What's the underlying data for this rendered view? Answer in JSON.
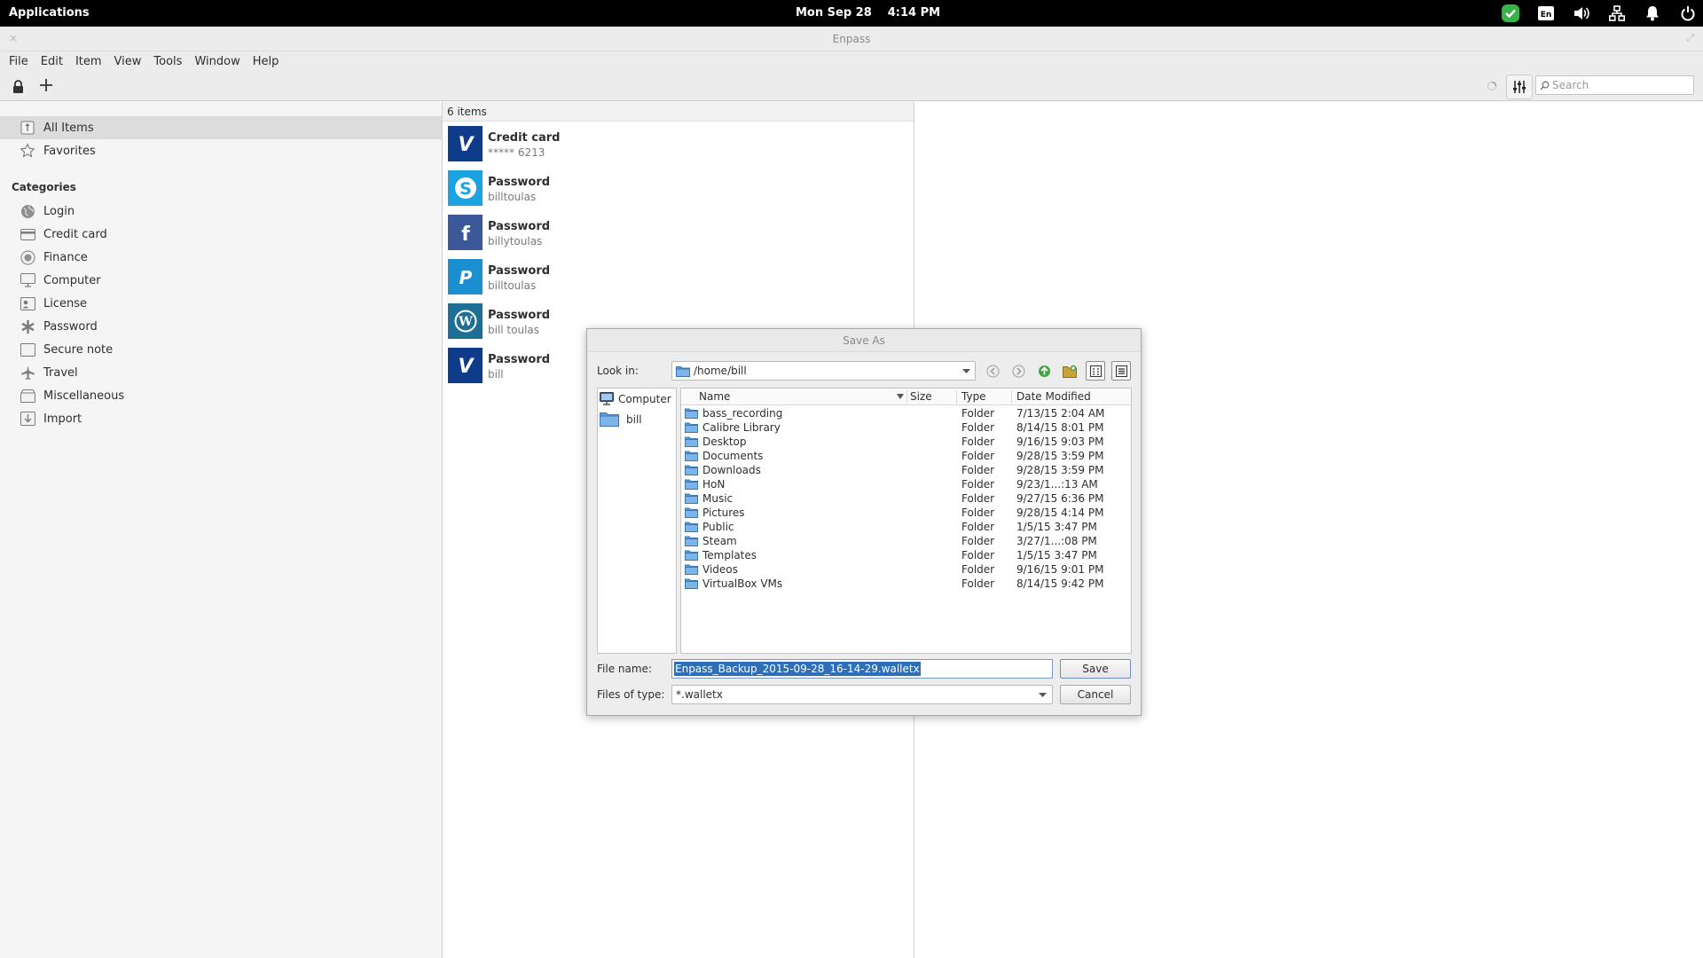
{
  "topbar": {
    "applications": "Applications",
    "date": "Mon Sep 28",
    "time": "4:14 PM",
    "tray": [
      "check-shield-icon",
      "keyboard-layout-icon",
      "volume-icon",
      "network-icon",
      "bell-icon",
      "power-icon"
    ],
    "keyboard_label": "En"
  },
  "window": {
    "title": "Enpass",
    "close": "×",
    "maximize": "⤢"
  },
  "menu": [
    "File",
    "Edit",
    "Item",
    "View",
    "Tools",
    "Window",
    "Help"
  ],
  "toolbar": {
    "search_placeholder": "Search"
  },
  "sidebar": {
    "top": [
      {
        "label": "All Items",
        "icon": "all-items-icon",
        "selected": true
      },
      {
        "label": "Favorites",
        "icon": "star-icon"
      }
    ],
    "categories_title": "Categories",
    "categories": [
      {
        "label": "Login",
        "icon": "globe-icon"
      },
      {
        "label": "Credit card",
        "icon": "credit-card-icon"
      },
      {
        "label": "Finance",
        "icon": "finance-icon"
      },
      {
        "label": "Computer",
        "icon": "computer-icon"
      },
      {
        "label": "License",
        "icon": "license-icon"
      },
      {
        "label": "Password",
        "icon": "asterisk-icon"
      },
      {
        "label": "Secure note",
        "icon": "note-icon"
      },
      {
        "label": "Travel",
        "icon": "plane-icon"
      },
      {
        "label": "Miscellaneous",
        "icon": "misc-icon"
      },
      {
        "label": "Import",
        "icon": "import-icon"
      }
    ]
  },
  "list": {
    "count": "6 items",
    "items": [
      {
        "title": "Credit card",
        "subtitle": "***** 6213",
        "logo": "visa-logo-icon",
        "color": "#0f3c8a",
        "glyph": "V"
      },
      {
        "title": "Password",
        "subtitle": "billtoulas",
        "logo": "skype-logo-icon",
        "color": "#1aa3e0",
        "glyph": "S"
      },
      {
        "title": "Password",
        "subtitle": "billytoulas",
        "logo": "facebook-logo-icon",
        "color": "#3b5998",
        "glyph": "f"
      },
      {
        "title": "Password",
        "subtitle": "billtoulas",
        "logo": "paypal-logo-icon",
        "color": "#1c8fd0",
        "glyph": "P"
      },
      {
        "title": "Password",
        "subtitle": "bill toulas",
        "logo": "wordpress-logo-icon",
        "color": "#1e6f95",
        "glyph": "W"
      },
      {
        "title": "Password",
        "subtitle": "bill",
        "logo": "visa-logo-icon",
        "color": "#0f3c8a",
        "glyph": "V"
      }
    ]
  },
  "dialog": {
    "title": "Save As",
    "look_in_label": "Look in:",
    "look_in_value": "/home/bill",
    "places": [
      {
        "label": "Computer",
        "icon": "computer-icon"
      },
      {
        "label": "bill",
        "icon": "folder-icon"
      }
    ],
    "columns": [
      "Name",
      "Size",
      "Type",
      "Date Modified"
    ],
    "files": [
      {
        "name": "bass_recording",
        "size": "",
        "type": "Folder",
        "date": "7/13/15 2:04 AM"
      },
      {
        "name": "Calibre Library",
        "size": "",
        "type": "Folder",
        "date": "8/14/15 8:01 PM"
      },
      {
        "name": "Desktop",
        "size": "",
        "type": "Folder",
        "date": "9/16/15 9:03 PM"
      },
      {
        "name": "Documents",
        "size": "",
        "type": "Folder",
        "date": "9/28/15 3:59 PM"
      },
      {
        "name": "Downloads",
        "size": "",
        "type": "Folder",
        "date": "9/28/15 3:59 PM"
      },
      {
        "name": "HoN",
        "size": "",
        "type": "Folder",
        "date": "9/23/1...:13 AM"
      },
      {
        "name": "Music",
        "size": "",
        "type": "Folder",
        "date": "9/27/15 6:36 PM"
      },
      {
        "name": "Pictures",
        "size": "",
        "type": "Folder",
        "date": "9/28/15 4:14 PM"
      },
      {
        "name": "Public",
        "size": "",
        "type": "Folder",
        "date": "1/5/15 3:47 PM"
      },
      {
        "name": "Steam",
        "size": "",
        "type": "Folder",
        "date": "3/27/1...:08 PM"
      },
      {
        "name": "Templates",
        "size": "",
        "type": "Folder",
        "date": "1/5/15 3:47 PM"
      },
      {
        "name": "Videos",
        "size": "",
        "type": "Folder",
        "date": "9/16/15 9:01 PM"
      },
      {
        "name": "VirtualBox VMs",
        "size": "",
        "type": "Folder",
        "date": "8/14/15 9:42 PM"
      }
    ],
    "file_name_label": "File name:",
    "file_name_value": "Enpass_Backup_2015-09-28_16-14-29.walletx",
    "file_type_label": "Files of type:",
    "file_type_value": "*.walletx",
    "save_label": "Save",
    "cancel_label": "Cancel"
  }
}
